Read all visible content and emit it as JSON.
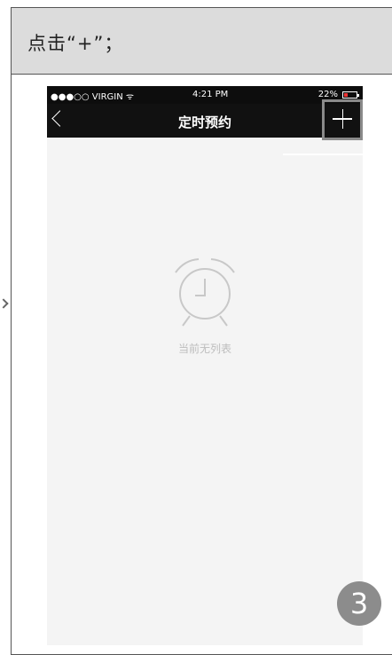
{
  "instruction": "点击“+”；",
  "status_bar": {
    "carrier": "●●●○○ VIRGIN ᯤ",
    "time": "4:21 PM",
    "battery": "22%"
  },
  "nav": {
    "title": "定时预约",
    "back_icon": "chevron-left-icon",
    "add_icon": "plus-icon"
  },
  "empty_state": {
    "icon": "alarm-clock-icon",
    "text": "当前无列表"
  },
  "step_badge": "3",
  "colors": {
    "header_bg": "#dcdcdc",
    "navbar_bg": "#111111",
    "screen_bg": "#f4f4f4",
    "badge_bg": "#8c8c8c",
    "highlight_border": "#8a8a8a"
  }
}
